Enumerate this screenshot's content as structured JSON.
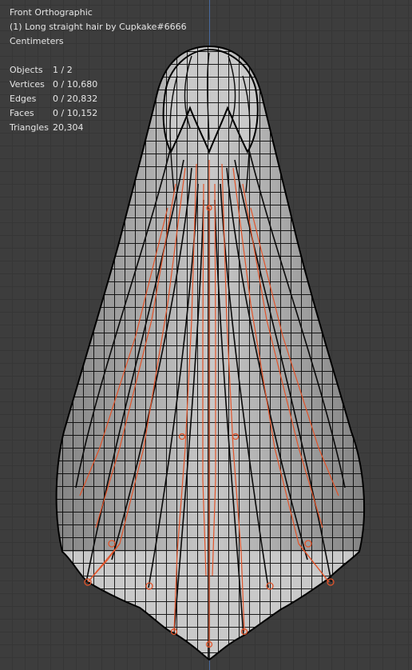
{
  "viewport": {
    "view_name": "Front Orthographic",
    "object_name": "(1) Long straight hair by Cupkake#6666",
    "units": "Centimeters"
  },
  "stats": [
    {
      "label": "Objects",
      "value": "1 / 2"
    },
    {
      "label": "Vertices",
      "value": "0 / 10,680"
    },
    {
      "label": "Edges",
      "value": "0 / 20,832"
    },
    {
      "label": "Faces",
      "value": "0 / 10,152"
    },
    {
      "label": "Triangles",
      "value": "20,304"
    }
  ],
  "colors": {
    "background": "#3d3d3d",
    "grid": "#363636",
    "axis": "#4a6fa8",
    "mesh_fill": "#c9c9c9",
    "wire": "#111111",
    "armature": "#e2542a",
    "text": "#e6e6e6"
  }
}
